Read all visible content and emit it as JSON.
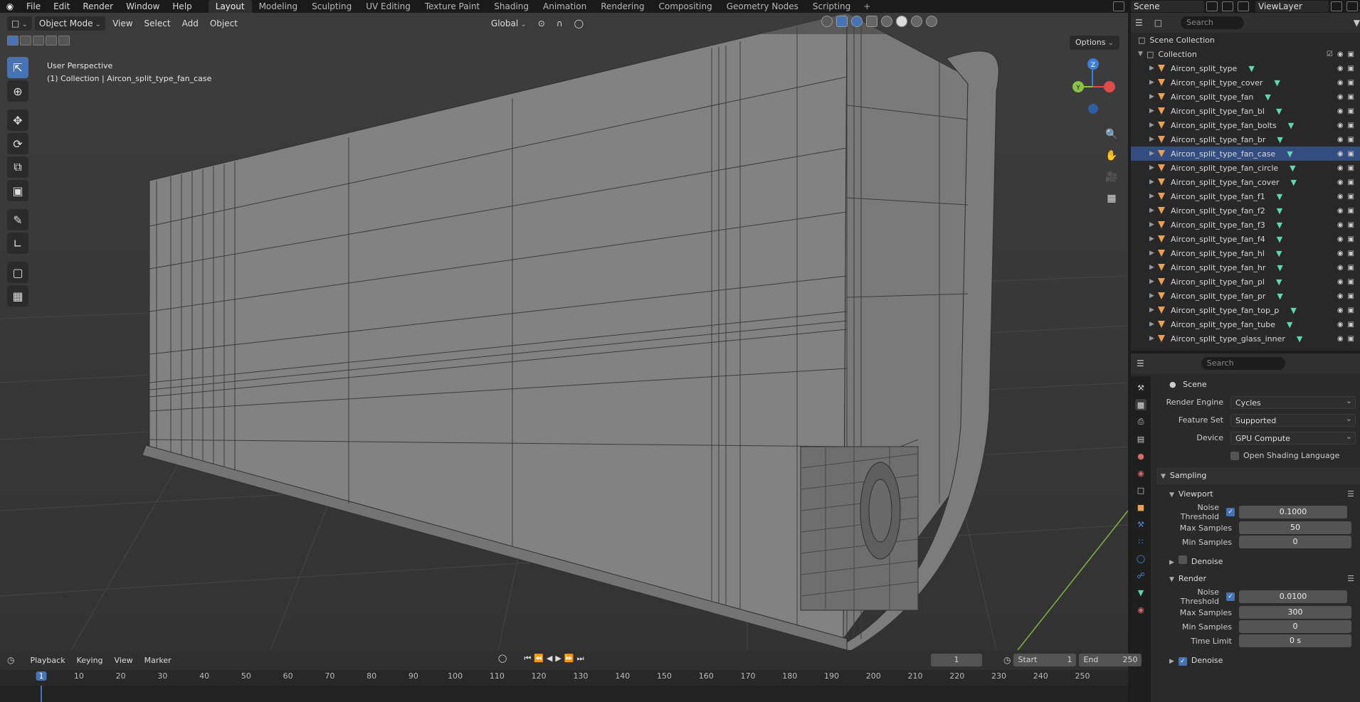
{
  "topbar": {
    "menu": [
      "File",
      "Edit",
      "Render",
      "Window",
      "Help"
    ],
    "workspaces": [
      "Layout",
      "Modeling",
      "Sculpting",
      "UV Editing",
      "Texture Paint",
      "Shading",
      "Animation",
      "Rendering",
      "Compositing",
      "Geometry Nodes",
      "Scripting"
    ],
    "active_workspace": "Layout",
    "add_tab": "+",
    "scene": "Scene",
    "view_layer": "ViewLayer"
  },
  "viewport": {
    "mode": "Object Mode",
    "menus": [
      "View",
      "Select",
      "Add",
      "Object"
    ],
    "transform_orientation": "Global",
    "options": "Options",
    "info_line1": "User Perspective",
    "info_line2": "(1) Collection | Aircon_split_type_fan_case",
    "gizmo_axes": {
      "z": "Z",
      "y": "Y"
    }
  },
  "outliner": {
    "search_placeholder": "Search",
    "scene_collection": "Scene Collection",
    "collection": "Collection",
    "items": [
      {
        "name": "Aircon_split_type",
        "selected": false
      },
      {
        "name": "Aircon_split_type_cover",
        "selected": false
      },
      {
        "name": "Aircon_split_type_fan",
        "selected": false
      },
      {
        "name": "Aircon_split_type_fan_bl",
        "selected": false
      },
      {
        "name": "Aircon_split_type_fan_bolts",
        "selected": false
      },
      {
        "name": "Aircon_split_type_fan_br",
        "selected": false
      },
      {
        "name": "Aircon_split_type_fan_case",
        "selected": true
      },
      {
        "name": "Aircon_split_type_fan_circle",
        "selected": false
      },
      {
        "name": "Aircon_split_type_fan_cover",
        "selected": false
      },
      {
        "name": "Aircon_split_type_fan_f1",
        "selected": false
      },
      {
        "name": "Aircon_split_type_fan_f2",
        "selected": false
      },
      {
        "name": "Aircon_split_type_fan_f3",
        "selected": false
      },
      {
        "name": "Aircon_split_type_fan_f4",
        "selected": false
      },
      {
        "name": "Aircon_split_type_fan_hl",
        "selected": false
      },
      {
        "name": "Aircon_split_type_fan_hr",
        "selected": false
      },
      {
        "name": "Aircon_split_type_fan_pl",
        "selected": false
      },
      {
        "name": "Aircon_split_type_fan_pr",
        "selected": false
      },
      {
        "name": "Aircon_split_type_fan_top_p",
        "selected": false
      },
      {
        "name": "Aircon_split_type_fan_tube",
        "selected": false
      },
      {
        "name": "Aircon_split_type_glass_inner",
        "selected": false
      }
    ]
  },
  "properties": {
    "search_placeholder": "Search",
    "context": "Scene",
    "render_engine_label": "Render Engine",
    "render_engine": "Cycles",
    "feature_set_label": "Feature Set",
    "feature_set": "Supported",
    "device_label": "Device",
    "device": "GPU Compute",
    "osl": "Open Shading Language",
    "sampling": "Sampling",
    "viewport_section": "Viewport",
    "noise_threshold_label": "Noise Threshold",
    "viewport_noise_threshold": "0.1000",
    "max_samples_label": "Max Samples",
    "viewport_max_samples": "50",
    "min_samples_label": "Min Samples",
    "viewport_min_samples": "0",
    "denoise": "Denoise",
    "render_section": "Render",
    "render_noise_threshold": "0.0100",
    "render_max_samples": "300",
    "render_min_samples": "0",
    "time_limit_label": "Time Limit",
    "time_limit": "0 s"
  },
  "timeline": {
    "menus": [
      "Playback",
      "Keying",
      "View",
      "Marker"
    ],
    "current_frame": "1",
    "start_label": "Start",
    "start": "1",
    "end_label": "End",
    "end": "250",
    "ticks": [
      "1",
      "10",
      "20",
      "30",
      "40",
      "50",
      "60",
      "70",
      "80",
      "90",
      "100",
      "110",
      "120",
      "130",
      "140",
      "150",
      "160",
      "170",
      "180",
      "190",
      "200",
      "210",
      "220",
      "230",
      "240",
      "250"
    ]
  },
  "colors": {
    "accent": "#4772b3",
    "object_icon": "#e9a050",
    "mesh_data": "#5fd8b0",
    "axis_x": "#e04a4a",
    "axis_y": "#8bc34a",
    "axis_z": "#3d7ed6"
  }
}
